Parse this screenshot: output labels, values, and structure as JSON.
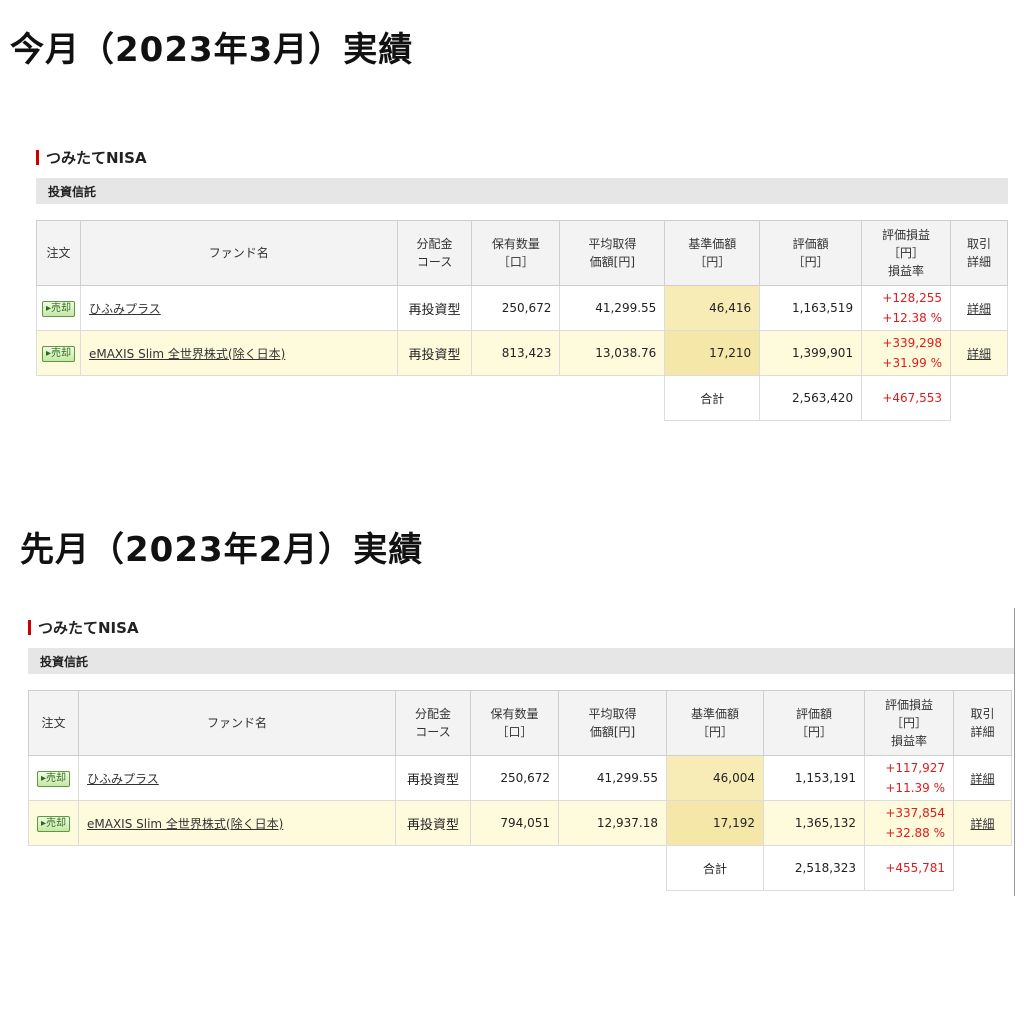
{
  "sections": [
    {
      "title": "今月（2023年3月）実績",
      "account": "つみたてNISA",
      "category": "投資信託",
      "headers": {
        "order": "注文",
        "fund": "ファンド名",
        "dist": [
          "分配金",
          "コース"
        ],
        "qty": [
          "保有数量",
          "［口］"
        ],
        "avg": [
          "平均取得",
          "価額[円]"
        ],
        "price": [
          "基準価額",
          "［円］"
        ],
        "value": [
          "評価額",
          "［円］"
        ],
        "pl": [
          "評価損益",
          "［円］",
          "損益率"
        ],
        "trade": [
          "取引",
          "詳細"
        ]
      },
      "rows": [
        {
          "order": "▸売却",
          "fund": "ひふみプラス",
          "dist": "再投資型",
          "qty": "250,672",
          "avg": "41,299.55",
          "price": "46,416",
          "value": "1,163,519",
          "pl": "+128,255",
          "rate": "+12.38 %",
          "detail": "詳細"
        },
        {
          "order": "▸売却",
          "fund": "eMAXIS Slim 全世界株式(除く日本)",
          "dist": "再投資型",
          "qty": "813,423",
          "avg": "13,038.76",
          "price": "17,210",
          "value": "1,399,901",
          "pl": "+339,298",
          "rate": "+31.99 %",
          "detail": "詳細"
        }
      ],
      "total": {
        "label": "合計",
        "value": "2,563,420",
        "pl": "+467,553"
      }
    },
    {
      "title": "先月（2023年2月）実績",
      "account": "つみたてNISA",
      "category": "投資信託",
      "headers": {
        "order": "注文",
        "fund": "ファンド名",
        "dist": [
          "分配金",
          "コース"
        ],
        "qty": [
          "保有数量",
          "［口］"
        ],
        "avg": [
          "平均取得",
          "価額[円]"
        ],
        "price": [
          "基準価額",
          "［円］"
        ],
        "value": [
          "評価額",
          "［円］"
        ],
        "pl": [
          "評価損益",
          "［円］",
          "損益率"
        ],
        "trade": [
          "取引",
          "詳細"
        ]
      },
      "rows": [
        {
          "order": "▸売却",
          "fund": "ひふみプラス",
          "dist": "再投資型",
          "qty": "250,672",
          "avg": "41,299.55",
          "price": "46,004",
          "value": "1,153,191",
          "pl": "+117,927",
          "rate": "+11.39 %",
          "detail": "詳細"
        },
        {
          "order": "▸売却",
          "fund": "eMAXIS Slim 全世界株式(除く日本)",
          "dist": "再投資型",
          "qty": "794,051",
          "avg": "12,937.18",
          "price": "17,192",
          "value": "1,365,132",
          "pl": "+337,854",
          "rate": "+32.88 %",
          "detail": "詳細"
        }
      ],
      "total": {
        "label": "合計",
        "value": "2,518,323",
        "pl": "+455,781"
      }
    }
  ]
}
